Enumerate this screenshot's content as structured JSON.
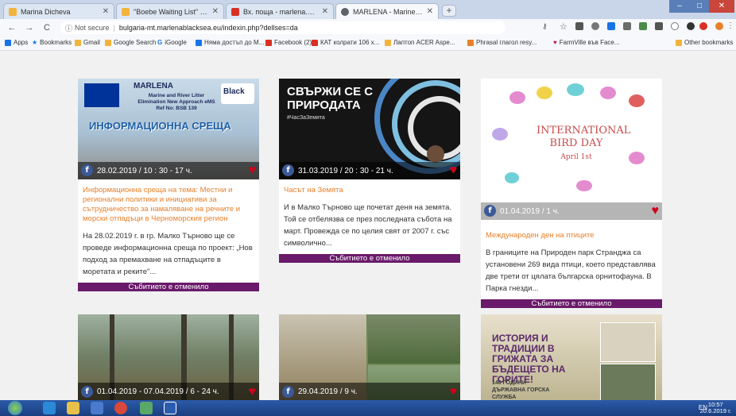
{
  "tabs": [
    {
      "label": "Marina Dicheva",
      "color": "#f2b33d"
    },
    {
      "label": "\"Boebe Waiting List\" (23) - dichev",
      "color": "#f2b33d"
    },
    {
      "label": "Вх. поща - marlena.blacksea@gm",
      "color": "#d93025"
    },
    {
      "label": "MARLENA - Marine and River Litt",
      "color": "#5f6368"
    }
  ],
  "window": {
    "minimize": "‒",
    "maximize": "□",
    "close": "✕"
  },
  "address": {
    "security": "Not secure",
    "url": "bulgaria-mt.marlenablacksea.eu/indexin.php?dellses=da"
  },
  "bookmarks": [
    {
      "label": "Apps",
      "color": "#1a73e8"
    },
    {
      "label": "Bookmarks",
      "color": "#1a73e8"
    },
    {
      "label": "Gmail",
      "color": "#f2b33d"
    },
    {
      "label": "Google Search",
      "color": "#f2b33d"
    },
    {
      "label": "iGoogle",
      "color": "#1a73e8"
    },
    {
      "label": "Няма достъп до М...",
      "color": "#1a73e8"
    },
    {
      "label": "Facebook (2)",
      "color": "#d93025"
    },
    {
      "label": "КАТ колрати 106 х...",
      "color": "#d93025"
    },
    {
      "label": "Лаптоп ACER Aspe...",
      "color": "#f2b33d"
    },
    {
      "label": "Phrasal глагол resy...",
      "color": "#e8802a"
    },
    {
      "label": "FarmVille във Face...",
      "color": "#c2185b"
    },
    {
      "label": "Other bookmarks",
      "color": "#f2b33d"
    }
  ],
  "cards": [
    {
      "image_heading": "MARLENA",
      "image_sub": "Marine and River Litter Elimination New Approach eMS Ref No: BSB 139",
      "image_banner": "ИНФОРМАЦИОННА СРЕЩА",
      "caption": "28.02.2019 / 10 : 30 - 17 ч.",
      "title": "Информационна среща на тема: Местни и регионални политики и инициативи за сътрудничество за намаляване на речните и морски отпадъци в Черноморския регион",
      "description": "На 28.02.2019 г. в гр. Малко Търново ще се проведе информационна среща по проект: „Нов подход за премахване на отпадъците в моретата и реките\"...",
      "status": "Събитието е отменило"
    },
    {
      "image_heading": "СВЪРЖИ СЕ С ПРИРОДАТА",
      "image_sub": "#ЧасЗаЗемята",
      "caption": "31.03.2019 / 20 : 30 - 21 ч.",
      "title": "Часът на Земята",
      "description": "И в Малко Търново ще почетат деня на земята. Той се отбелязва се през последната събота на март. Провежда се по целия свят от 2007 г. със символично...",
      "status": "Събитието е отменило"
    },
    {
      "image_heading": "INTERNATIONAL BIRD DAY",
      "image_sub": "April 1st",
      "caption": "01.04.2019 / 1 ч.",
      "title": "Международен ден на птиците",
      "description": "В границите на Природен парк Странджа са установени 269 вида птици, което представлява две трети от цялата българска орнитофауна. В Парка гнезди...",
      "status": "Събитието е отменило"
    },
    {
      "caption": "01.04.2019 - 07.04.2019 / 6 - 24 ч."
    },
    {
      "caption": "29.04.2019 / 9 ч."
    },
    {
      "image_heading": "ИСТОРИЯ И ТРАДИЦИИ В ГРИЖАТА ЗА БЪДЕЩЕТО НА ГОРИТЕ!",
      "image_sub": "140 ГОДИНИ ДЪРЖАВНА ГОРСКА СЛУЖБА"
    }
  ],
  "taskbar": {
    "tray": "EN",
    "time": "10:57",
    "date": "20.6.2019 г."
  }
}
